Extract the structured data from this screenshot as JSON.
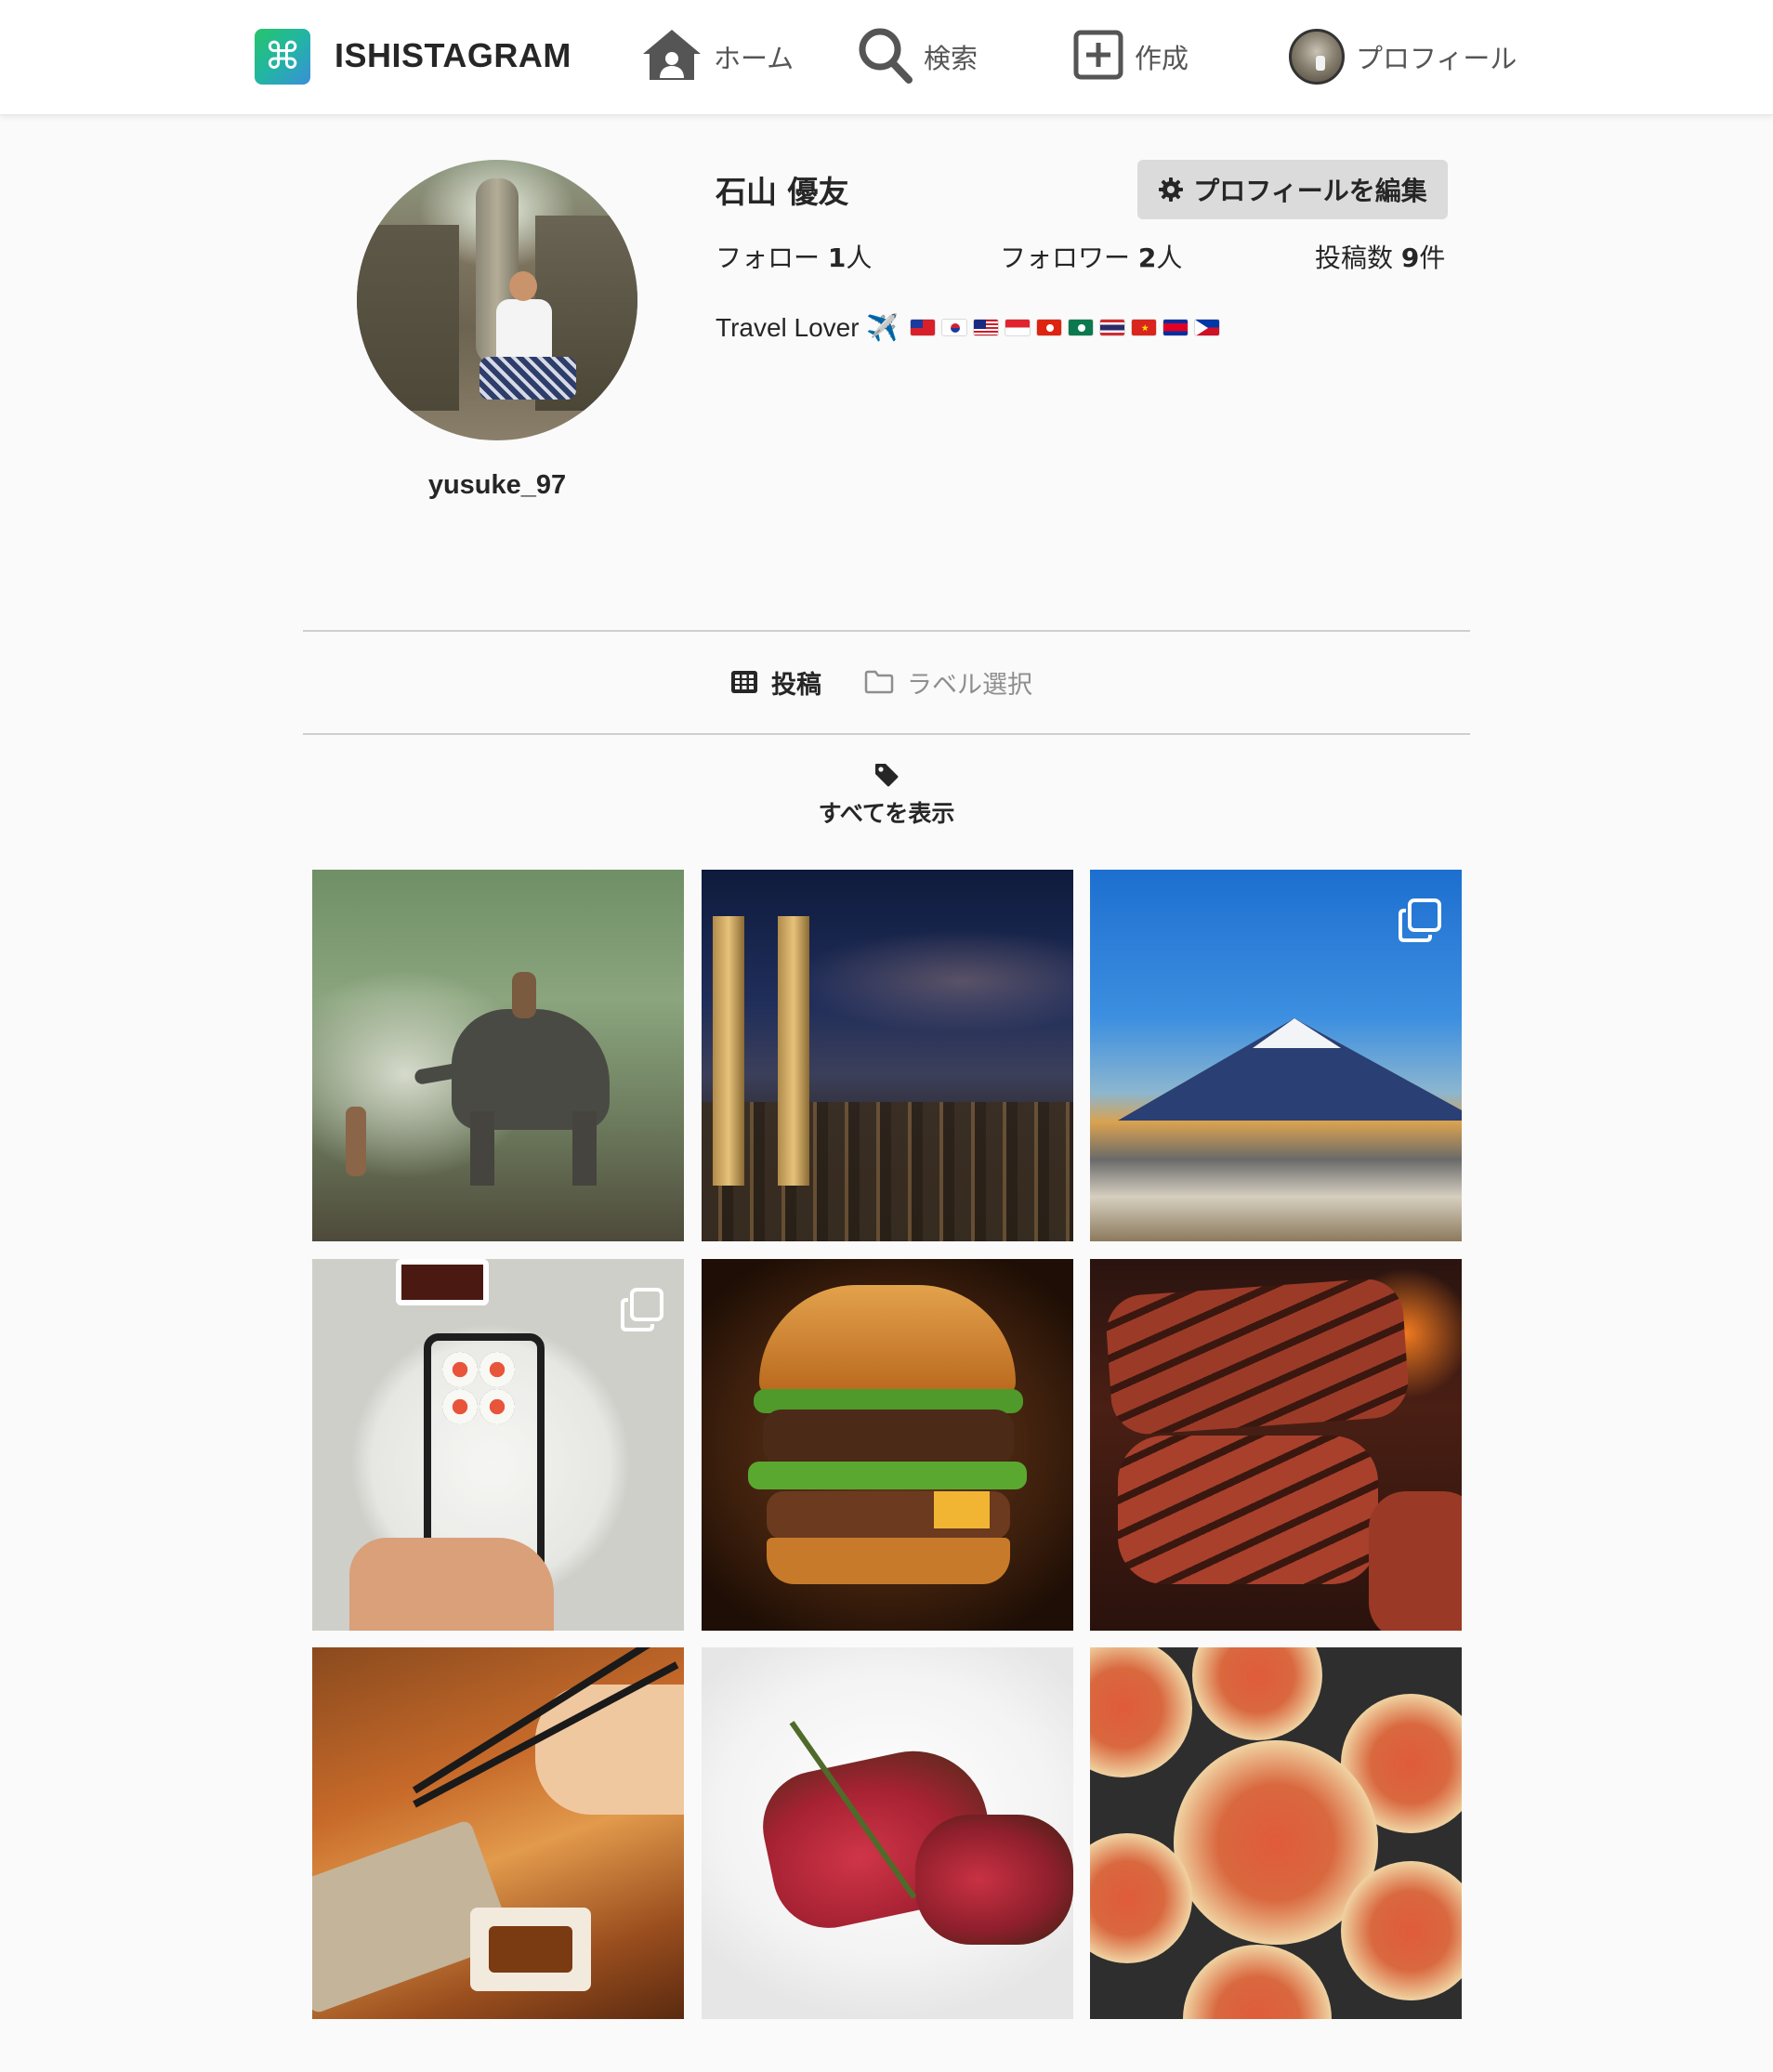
{
  "header": {
    "logo_glyph": "⌘",
    "brand": "ISHISTAGRAM",
    "nav": [
      {
        "label": "ホーム",
        "icon": "home-icon"
      },
      {
        "label": "検索",
        "icon": "search-icon"
      },
      {
        "label": "作成",
        "icon": "plus-square-icon"
      },
      {
        "label": "プロフィール",
        "icon": "avatar"
      }
    ]
  },
  "profile": {
    "username": "yusuke_97",
    "full_name": "石山 優友",
    "edit_button_label": "プロフィールを編集",
    "stats": {
      "following_label": "フォロー",
      "following_count": "1",
      "followers_label": "フォロワー",
      "followers_count": "2",
      "posts_label": "投稿数",
      "posts_count": "9",
      "person_unit": "人",
      "posts_unit": "件"
    },
    "bio": "Travel Lover ✈️",
    "bio_flags": [
      "taiwan",
      "south-korea",
      "malaysia",
      "singapore",
      "hong-kong",
      "macau",
      "thailand",
      "vietnam",
      "cambodia",
      "philippines"
    ]
  },
  "tabs": [
    {
      "label": "投稿",
      "icon": "grid-icon",
      "active": true
    },
    {
      "label": "ラベル選択",
      "icon": "folder-icon",
      "active": false
    }
  ],
  "filter": {
    "label": "すべてを表示",
    "icon": "tag-icon"
  },
  "posts": [
    {
      "subject": "elephant",
      "multi": false
    },
    {
      "subject": "city-night",
      "multi": false
    },
    {
      "subject": "mount-fuji",
      "multi": true
    },
    {
      "subject": "sushi",
      "multi": true
    },
    {
      "subject": "burger",
      "multi": false
    },
    {
      "subject": "grilled-steak",
      "multi": false
    },
    {
      "subject": "sashimi-chopsticks",
      "multi": false
    },
    {
      "subject": "sliced-beef",
      "multi": false
    },
    {
      "subject": "pizzas",
      "multi": false
    }
  ],
  "colors": {
    "background": "#fafafa",
    "header_bg": "#ffffff",
    "text": "#262626",
    "muted": "#8e8e8e",
    "button_bg": "#dbdbdb",
    "logo_gradient_start": "#27c46b",
    "logo_gradient_end": "#3a8fd9"
  }
}
